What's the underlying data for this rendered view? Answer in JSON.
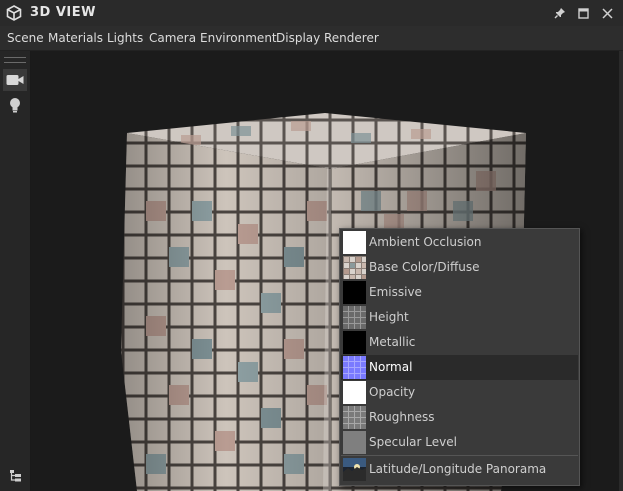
{
  "window": {
    "title": "3D VIEW"
  },
  "menu": {
    "items": [
      "Scene",
      "Materials",
      "Lights",
      "Camera",
      "Environment",
      "Display",
      "Renderer"
    ]
  },
  "channels": {
    "items": [
      {
        "label": "Ambient Occlusion",
        "thumb": "white-swatch"
      },
      {
        "label": "Base Color/Diffuse",
        "thumb": "tile-color-swatch"
      },
      {
        "label": "Emissive",
        "thumb": "black-swatch"
      },
      {
        "label": "Height",
        "thumb": "gray-grid-swatch"
      },
      {
        "label": "Metallic",
        "thumb": "black-swatch"
      },
      {
        "label": "Normal",
        "thumb": "blue-normal-swatch"
      },
      {
        "label": "Opacity",
        "thumb": "white-swatch"
      },
      {
        "label": "Roughness",
        "thumb": "gray-grid-swatch"
      },
      {
        "label": "Specular Level",
        "thumb": "gray-swatch"
      },
      {
        "label": "Latitude/Longitude Panorama",
        "thumb": "panorama-swatch"
      }
    ],
    "selected": "Normal"
  },
  "colors": {
    "titlebar": "#2a2a2a",
    "menubar": "#2d2d2d",
    "viewport": "#1b1b1b",
    "dropdown": "#3a3a3a",
    "selected_row": "#2a2a2a",
    "normal_blue": "#7a7aff"
  },
  "icons": {
    "app": "cube-icon",
    "pin": "pin-icon",
    "maximize": "maximize-icon",
    "close": "close-icon",
    "camera": "camera-icon",
    "light": "lightbulb-icon",
    "tree": "scene-tree-icon"
  }
}
